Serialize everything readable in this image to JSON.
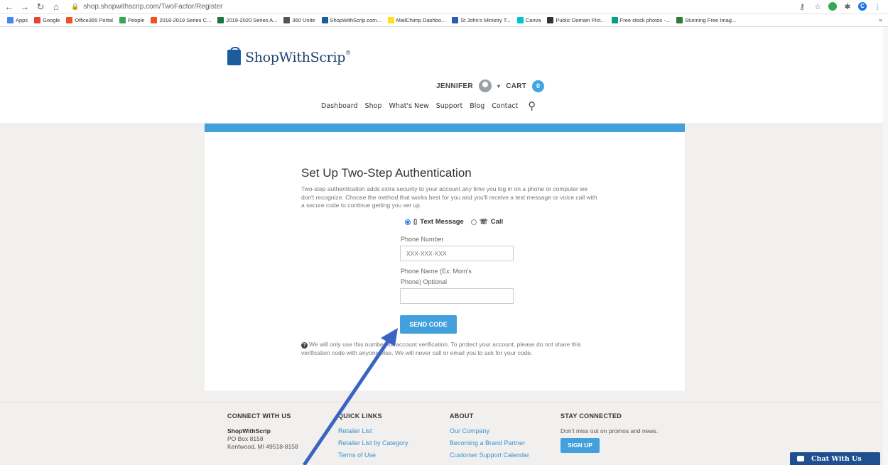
{
  "browser": {
    "url": "shop.shopwithscrip.com/TwoFactor/Register",
    "profile_initial": "C",
    "bookmarks": [
      {
        "label": "Apps",
        "color": "#4285f4"
      },
      {
        "label": "Google",
        "color": "#ea4335"
      },
      {
        "label": "Office365 Portal",
        "color": "#f25022"
      },
      {
        "label": "People",
        "color": "#34a853"
      },
      {
        "label": "2018-2019 Series C...",
        "color": "#f25022"
      },
      {
        "label": "2019-2020 Series A...",
        "color": "#1e7145"
      },
      {
        "label": "360 Unite",
        "color": "#555555"
      },
      {
        "label": "ShopWithScrip.com...",
        "color": "#1d5b9f"
      },
      {
        "label": "MailChimp Dashbo...",
        "color": "#ffe01b"
      },
      {
        "label": "St John's Ministry T...",
        "color": "#2a5db0"
      },
      {
        "label": "Canva",
        "color": "#00c4cc"
      },
      {
        "label": "Public Domain Pict...",
        "color": "#333333"
      },
      {
        "label": "Free stock photos -...",
        "color": "#05a081"
      },
      {
        "label": "Stunning Free Imag...",
        "color": "#2e7d32"
      }
    ]
  },
  "header": {
    "logo_text": "ShopWithScrip",
    "user_name": "JENNIFER",
    "cart_label": "CART",
    "cart_count": "0",
    "nav": [
      "Dashboard",
      "Shop",
      "What's New",
      "Support",
      "Blog",
      "Contact"
    ]
  },
  "panel": {
    "title": "Set Up Two-Step Authentication",
    "intro": "Two-step authentication adds extra security to your account any time you log in on a phone or computer we don't recognize. Choose the method that works best for you and you'll receive a text message or voice call with a secure code to continue getting you set up.",
    "method_text": "Text Message",
    "method_call": "Call",
    "phone_number_label": "Phone Number",
    "phone_number_placeholder": "XXX-XXX-XXX",
    "phone_name_label_1": "Phone Name (Ex: Mom's",
    "phone_name_label_2": "Phone) Optional",
    "send_button": "SEND CODE",
    "note": "We will only use this number for account verification. To protect your account, please do not share this verification code with anyone else. We will never call or email you to ask for your code."
  },
  "footer": {
    "connect_head": "CONNECT WITH US",
    "company": "ShopWithScrip",
    "address_1": "PO Box 8158",
    "address_2": "Kentwood, MI  49518-8158",
    "quick_head": "QUICK LINKS",
    "quick_links": [
      "Retailer List",
      "Retailer List by Category",
      "Terms of Use"
    ],
    "about_head": "ABOUT",
    "about_links": [
      "Our Company",
      "Becoming a Brand Partner",
      "Customer Support Calendar"
    ],
    "stay_head": "STAY CONNECTED",
    "stay_text": "Don't miss out on promos and news.",
    "signup": "SIGN UP"
  },
  "chat": {
    "label": "Chat With Us"
  },
  "colors": {
    "accent": "#42a0dc",
    "brand": "#1d5b9f",
    "chat": "#1f4f8e",
    "arrow": "#3b63c4"
  }
}
